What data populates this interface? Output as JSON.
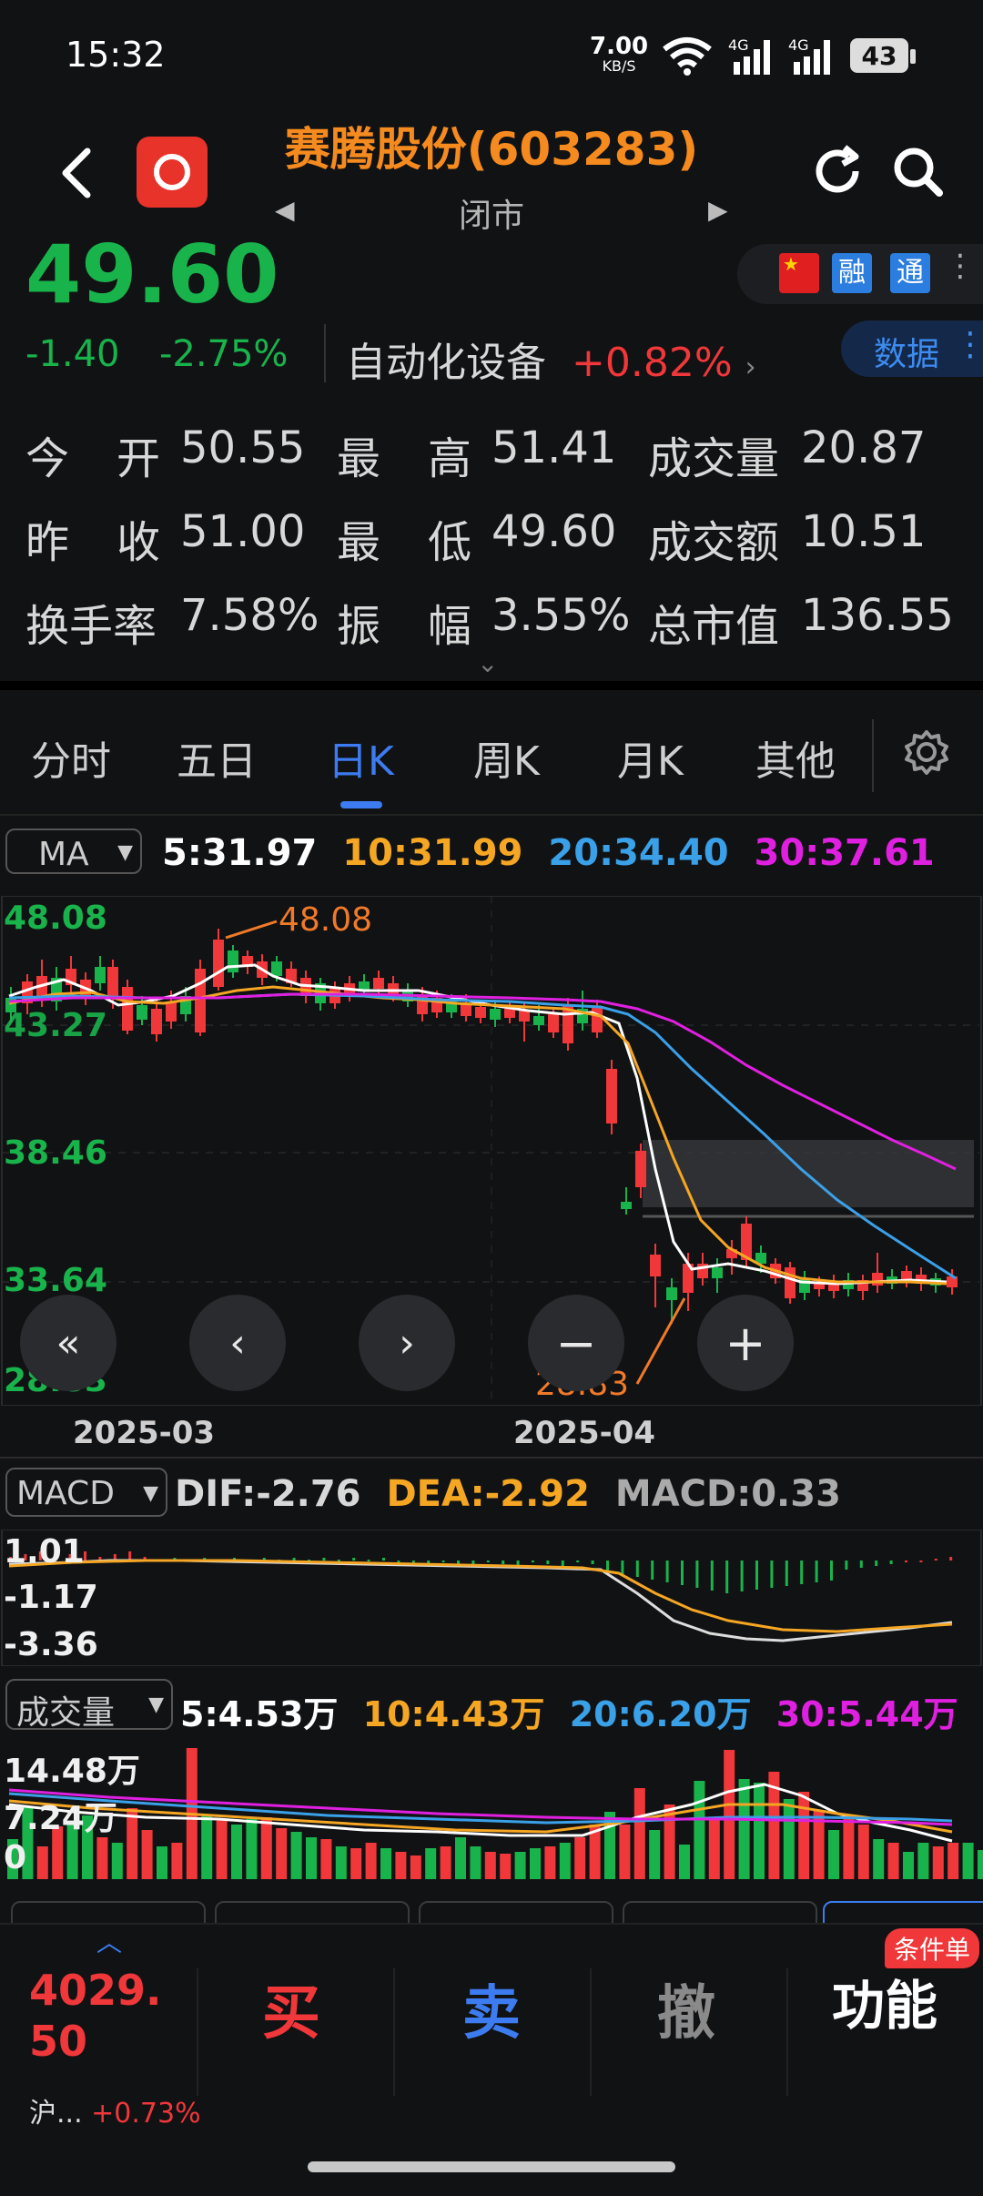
{
  "status_bar": {
    "time": "15:32",
    "net_speed": "7.00",
    "net_unit": "KB/S",
    "signal1": "4G",
    "signal2": "4G",
    "battery": "43"
  },
  "header": {
    "title": "赛腾股份(603283)",
    "market_status": "闭市"
  },
  "quote": {
    "price": "49.60",
    "change": "-1.40",
    "change_pct": "-2.75%",
    "sector_name": "自动化设备",
    "sector_pct": "+0.82%",
    "tags": [
      "融",
      "通"
    ],
    "data_button": "数据",
    "stats": [
      [
        "今",
        "开",
        "50.55",
        "最",
        "高",
        "51.41",
        "成交量",
        "20.87"
      ],
      [
        "昨",
        "收",
        "51.00",
        "最",
        "低",
        "49.60",
        "成交额",
        "10.51"
      ],
      [
        "换手率",
        "",
        "7.58%",
        "振",
        "幅",
        "3.55%",
        "总市值",
        "136.55"
      ]
    ]
  },
  "tabs": [
    "分时",
    "五日",
    "日K",
    "周K",
    "月K",
    "其他"
  ],
  "active_tab": "日K",
  "ma": {
    "selector": "MA",
    "ma5": "5:31.97",
    "ma10": "10:31.99",
    "ma20": "20:34.40",
    "ma30": "30:37.61"
  },
  "kline_axis": [
    "48.08",
    "43.27",
    "38.46",
    "33.64",
    "28.83"
  ],
  "kline_hi_label": "48.08",
  "kline_lo_label": "28.83",
  "dates": [
    "2025-03",
    "2025-04"
  ],
  "macd": {
    "selector": "MACD",
    "dif": "DIF:-2.76",
    "dea": "DEA:-2.92",
    "macd": "MACD:0.33",
    "axis": [
      "1.01",
      "-1.17",
      "-3.36"
    ]
  },
  "volume": {
    "selector": "成交量",
    "v5": "5:4.53万",
    "v10": "10:4.43万",
    "v20": "20:6.20万",
    "v30": "30:5.44万",
    "axis": [
      "14.48万",
      "7.24万",
      "0"
    ]
  },
  "bottom": {
    "index_value": "4029.50",
    "index_name": "沪...",
    "index_pct": "+0.73%",
    "buy": "买",
    "sell": "卖",
    "cancel": "撤",
    "func": "功能",
    "badge": "条件单"
  },
  "colors": {
    "up": "#f0373a",
    "down": "#19b34c",
    "ma5": "#ffffff",
    "ma10": "#f5a623",
    "ma20": "#3aa0e8",
    "ma30": "#e020e0",
    "accent": "#3d7cf0"
  }
}
